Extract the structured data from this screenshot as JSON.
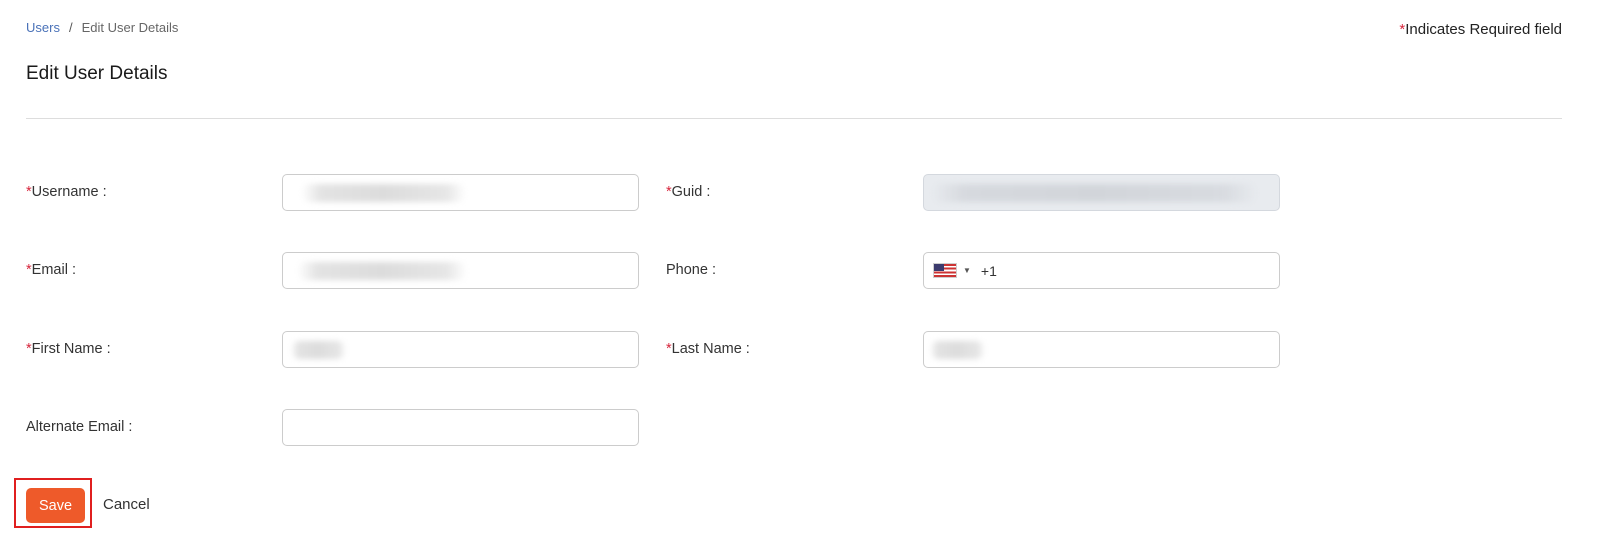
{
  "breadcrumb": {
    "root": "Users",
    "separator": "/",
    "current": "Edit User Details"
  },
  "required_note": {
    "asterisk": "*",
    "text": "Indicates Required field"
  },
  "title": "Edit User Details",
  "form": {
    "username": {
      "asterisk": "*",
      "label": "Username :",
      "value": ""
    },
    "guid": {
      "asterisk": "*",
      "label": "Guid :",
      "value": ""
    },
    "email": {
      "asterisk": "*",
      "label": "Email :",
      "value": ""
    },
    "phone": {
      "label": "Phone :",
      "country_flag": "us-flag-icon",
      "dial_code": "+1"
    },
    "first_name": {
      "asterisk": "*",
      "label": "First Name :",
      "value": ""
    },
    "last_name": {
      "asterisk": "*",
      "label": "Last Name :",
      "value": ""
    },
    "alternate_email": {
      "label": "Alternate Email :",
      "value": ""
    }
  },
  "actions": {
    "save_label": "Save",
    "cancel_label": "Cancel"
  },
  "colors": {
    "accent": "#ee5a2a",
    "required": "#d7263d",
    "link": "#4a72b8",
    "highlight": "#e01f1f"
  }
}
